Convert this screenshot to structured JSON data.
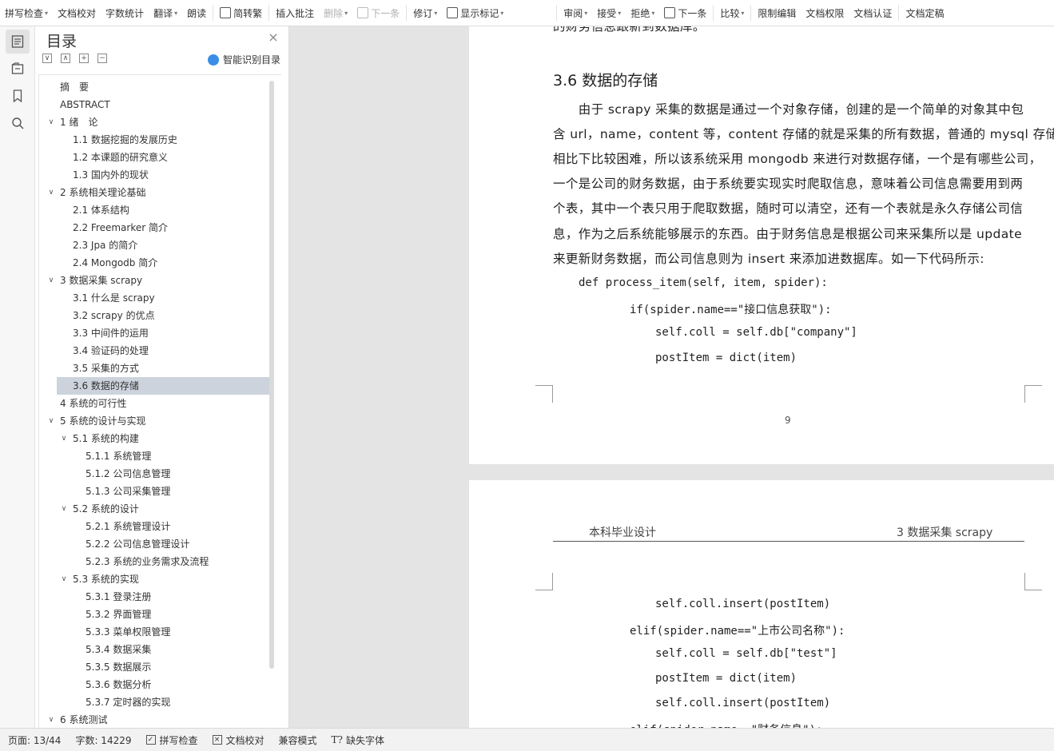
{
  "toolbar": {
    "items": [
      {
        "label": "拼写检查",
        "caret": "▾"
      },
      {
        "label": "文档校对",
        "caret": ""
      },
      {
        "label": "字数统计",
        "caret": ""
      },
      {
        "label": "翻译",
        "caret": "▾"
      },
      {
        "label": "朗读",
        "caret": ""
      },
      {
        "label": "简转繁",
        "caret": ""
      },
      {
        "label": "插入批注",
        "caret": ""
      },
      {
        "label": "删除",
        "caret": "▾"
      },
      {
        "label": "下一条",
        "caret": ""
      },
      {
        "label": "修订",
        "caret": "▾"
      },
      {
        "label": "显示标记",
        "caret": "▾"
      },
      {
        "label": "审阅",
        "caret": "▾"
      },
      {
        "label": "接受",
        "caret": "▾"
      },
      {
        "label": "拒绝",
        "caret": "▾"
      },
      {
        "label": "下一条",
        "caret": ""
      },
      {
        "label": "比较",
        "caret": "▾"
      },
      {
        "label": "限制编辑",
        "caret": ""
      },
      {
        "label": "文档权限",
        "caret": ""
      },
      {
        "label": "文档认证",
        "caret": ""
      },
      {
        "label": "文档定稿",
        "caret": ""
      }
    ]
  },
  "toc": {
    "title": "目录",
    "close": "×",
    "smart_label": "智能识别目录",
    "tools": [
      "∨",
      "∧",
      "+",
      "−"
    ],
    "items": [
      {
        "label": "摘　要",
        "level": 0,
        "chev": ""
      },
      {
        "label": "ABSTRACT",
        "level": 0,
        "chev": ""
      },
      {
        "label": "1  绪　论",
        "level": 0,
        "chev": "∨"
      },
      {
        "label": "1.1  数据挖掘的发展历史",
        "level": 1,
        "chev": ""
      },
      {
        "label": "1.2  本课题的研究意义",
        "level": 1,
        "chev": ""
      },
      {
        "label": "1.3  国内外的现状",
        "level": 1,
        "chev": ""
      },
      {
        "label": "2  系统相关理论基础",
        "level": 0,
        "chev": "∨"
      },
      {
        "label": "2.1  体系结构",
        "level": 1,
        "chev": ""
      },
      {
        "label": "2.2 Freemarker 简介",
        "level": 1,
        "chev": ""
      },
      {
        "label": "2.3 Jpa 的简介",
        "level": 1,
        "chev": ""
      },
      {
        "label": "2.4 Mongodb 简介",
        "level": 1,
        "chev": ""
      },
      {
        "label": "3  数据采集 scrapy",
        "level": 0,
        "chev": "∨"
      },
      {
        "label": "3.1  什么是 scrapy",
        "level": 1,
        "chev": ""
      },
      {
        "label": "3.2 scrapy 的优点",
        "level": 1,
        "chev": ""
      },
      {
        "label": "3.3  中间件的运用",
        "level": 1,
        "chev": ""
      },
      {
        "label": "3.4  验证码的处理",
        "level": 1,
        "chev": ""
      },
      {
        "label": "3.5  采集的方式",
        "level": 1,
        "chev": ""
      },
      {
        "label": "3.6  数据的存储",
        "level": 1,
        "chev": "",
        "selected": true
      },
      {
        "label": "4  系统的可行性",
        "level": 0,
        "chev": ""
      },
      {
        "label": "5  系统的设计与实现",
        "level": 0,
        "chev": "∨"
      },
      {
        "label": "5.1  系统的构建",
        "level": 1,
        "chev": "∨"
      },
      {
        "label": "5.1.1  系统管理",
        "level": 2,
        "chev": ""
      },
      {
        "label": "5.1.2  公司信息管理",
        "level": 2,
        "chev": ""
      },
      {
        "label": "5.1.3  公司采集管理",
        "level": 2,
        "chev": ""
      },
      {
        "label": "5.2  系统的设计",
        "level": 1,
        "chev": "∨"
      },
      {
        "label": "5.2.1  系统管理设计",
        "level": 2,
        "chev": ""
      },
      {
        "label": "5.2.2  公司信息管理设计",
        "level": 2,
        "chev": ""
      },
      {
        "label": "5.2.3  系统的业务需求及流程",
        "level": 2,
        "chev": ""
      },
      {
        "label": "5.3  系统的实现",
        "level": 1,
        "chev": "∨"
      },
      {
        "label": "5.3.1  登录注册",
        "level": 2,
        "chev": ""
      },
      {
        "label": "5.3.2  界面管理",
        "level": 2,
        "chev": ""
      },
      {
        "label": "5.3.3  菜单权限管理",
        "level": 2,
        "chev": ""
      },
      {
        "label": "5.3.4  数据采集",
        "level": 2,
        "chev": ""
      },
      {
        "label": "5.3.5  数据展示",
        "level": 2,
        "chev": ""
      },
      {
        "label": "5.3.6  数据分析",
        "level": 2,
        "chev": ""
      },
      {
        "label": "5.3.7  定时器的实现",
        "level": 2,
        "chev": ""
      },
      {
        "label": "6  系统测试",
        "level": 0,
        "chev": "∨"
      }
    ]
  },
  "page1": {
    "top_fragment": "的财务信息跟新到数据库。",
    "heading": "3.6  数据的存储",
    "para": [
      "　　由于 scrapy 采集的数据是通过一个对象存储，创建的是一个简单的对象其中包",
      "含 url，name，content 等，content 存储的就是采集的所有数据，普通的 mysql 存储",
      "相比下比较困难，所以该系统采用 mongodb 来进行对数据存储，一个是有哪些公司，",
      "一个是公司的财务数据，由于系统要实现实时爬取信息，意味着公司信息需要用到两",
      "个表，其中一个表只用于爬取数据，随时可以清空，还有一个表就是永久存储公司信",
      "息，作为之后系统能够展示的东西。由于财务信息是根据公司来采集所以是 update",
      "来更新财务数据，而公司信息则为 insert 来添加进数据库。如一下代码所示:"
    ],
    "code": [
      "def process_item(self, item, spider):",
      "if(spider.name==\"接口信息获取\"):",
      "self.coll = self.db[\"company\"]",
      "postItem = dict(item)"
    ],
    "page_number": "9"
  },
  "page2": {
    "header_left": "本科毕业设计",
    "header_right": "3 数据采集 scrapy",
    "code": [
      "self.coll.insert(postItem)",
      "elif(spider.name==\"上市公司名称\"):",
      "self.coll = self.db[\"test\"]",
      "postItem = dict(item)",
      "self.coll.insert(postItem)",
      "elif(spider.name==\"财务信息\"):"
    ]
  },
  "status": {
    "page": "页面: 13/44",
    "words": "字数: 14229",
    "spell": "拼写检查",
    "proof": "文档校对",
    "compat": "兼容模式",
    "missing_font": "缺失字体"
  }
}
